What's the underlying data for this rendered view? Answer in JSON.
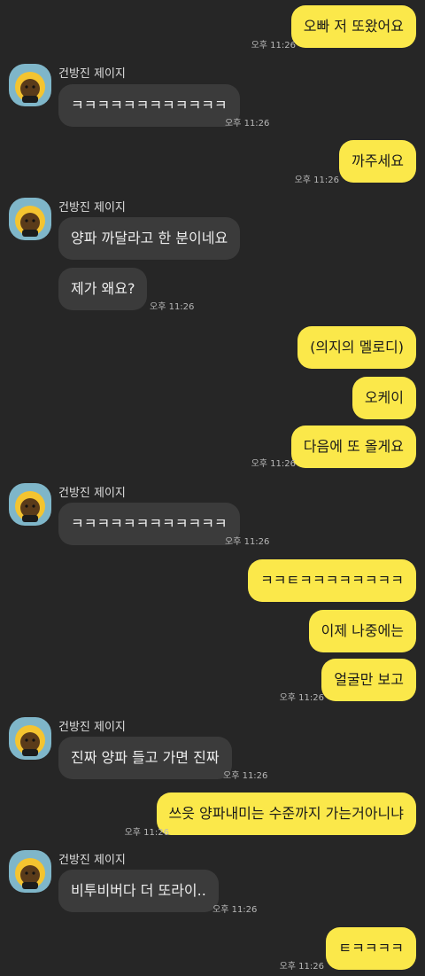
{
  "friend_name": "건방진 제이지",
  "messages": [
    {
      "from": "me",
      "text": "오빠 저 또왔어요",
      "time": "오후 11:26"
    },
    {
      "from": "friend",
      "text": "ㅋㅋㅋㅋㅋㅋㅋㅋㅋㅋㅋㅋ",
      "time": "오후 11:26"
    },
    {
      "from": "me",
      "text": "까주세요",
      "time": "오후 11:26"
    },
    {
      "from": "friend",
      "text": "양파 까달라고 한 분이네요",
      "time": ""
    },
    {
      "from": "friend",
      "text": "제가 왜요?",
      "time": "오후 11:26"
    },
    {
      "from": "me",
      "text": "(의지의 멜로디)",
      "time": ""
    },
    {
      "from": "me",
      "text": "오케이",
      "time": ""
    },
    {
      "from": "me",
      "text": "다음에 또 올게요",
      "time": "오후 11:26"
    },
    {
      "from": "friend",
      "text": "ㅋㅋㅋㅋㅋㅋㅋㅋㅋㅋㅋㅋ",
      "time": "오후 11:26"
    },
    {
      "from": "me",
      "text": "ㅋㅋㅌㅋㅋㅋㅋㅋㅋㅋㅋ",
      "time": ""
    },
    {
      "from": "me",
      "text": "이제 나중에는",
      "time": ""
    },
    {
      "from": "me",
      "text": "얼굴만 보고",
      "time": "오후 11:26"
    },
    {
      "from": "friend",
      "text": "진짜 양파 들고 가면 진짜",
      "time": "오후 11:26"
    },
    {
      "from": "me",
      "text": "쓰읏 양파내미는 수준까지 가는거아니냐",
      "time": "오후 11:26"
    },
    {
      "from": "friend",
      "text": "비투비버다 더 또라이..",
      "time": "오후 11:26"
    },
    {
      "from": "me",
      "text": "ㅌㅋㅋㅋㅋ",
      "time": "오후 11:26"
    }
  ],
  "colors": {
    "background": "#262626",
    "my_bubble": "#fbe84a",
    "their_bubble": "#3b3b3b",
    "avatar_bg": "#7fb6c9"
  },
  "icons": {
    "avatar": "cartoon-character-avatar-icon"
  }
}
